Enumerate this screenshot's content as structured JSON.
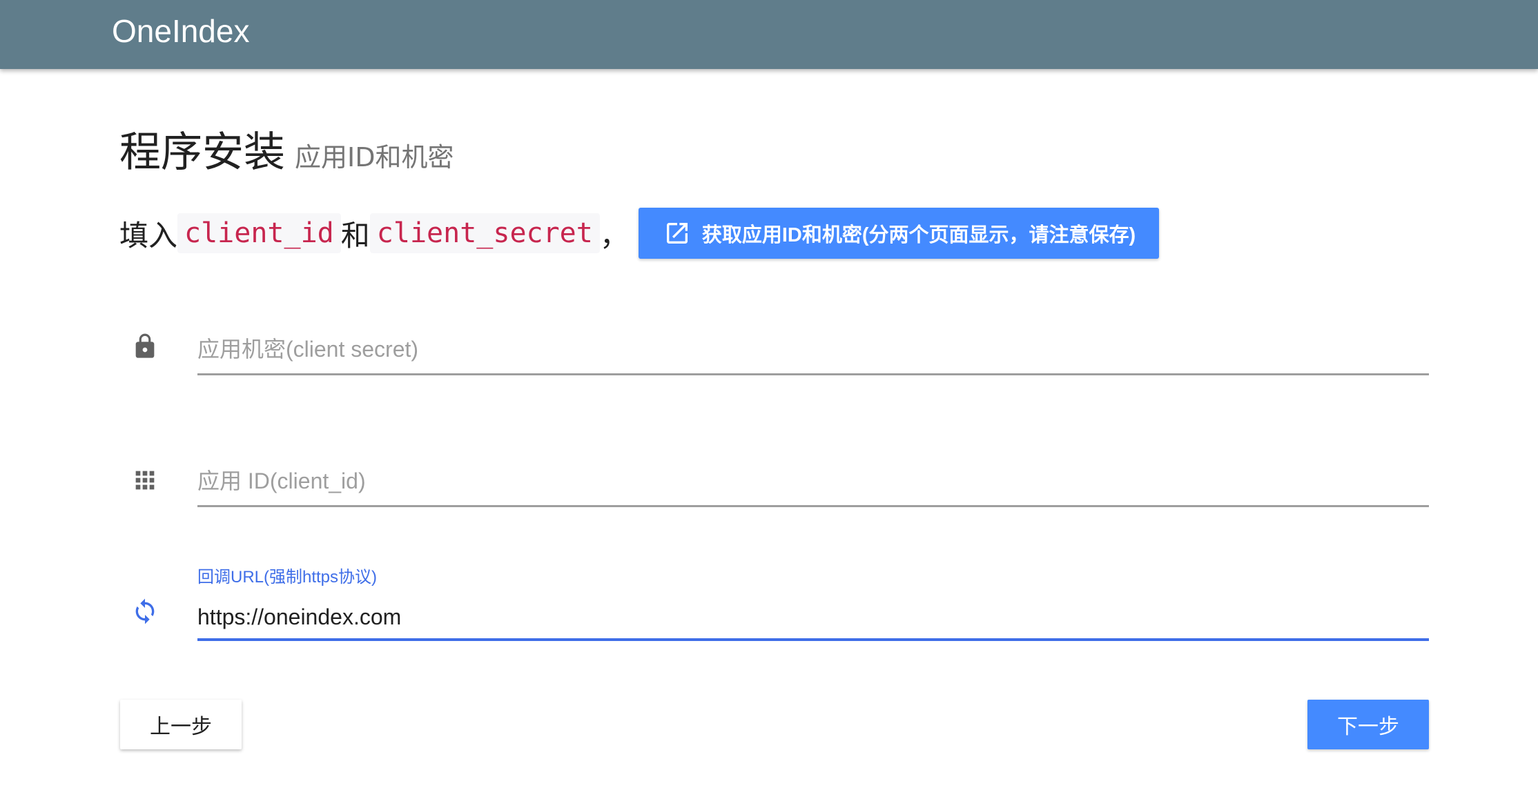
{
  "appbar": {
    "brand": "OneIndex"
  },
  "heading": {
    "title": "程序安装",
    "subtitle": "应用ID和机密"
  },
  "intro": {
    "prefix": "填入",
    "code1": "client_id",
    "joiner": "和",
    "code2": "client_secret",
    "suffix": "，",
    "link_button": "获取应用ID和机密(分两个页面显示，请注意保存)",
    "link_icon": "open-in-new-icon"
  },
  "fields": {
    "secret": {
      "placeholder": "应用机密(client secret)",
      "icon": "lock-icon",
      "value": ""
    },
    "client_id": {
      "placeholder": "应用 ID(client_id)",
      "icon": "apps-grid-icon",
      "value": ""
    },
    "redirect": {
      "label": "回调URL(强制https协议)",
      "value": "https://oneindex.com",
      "icon": "refresh-icon"
    }
  },
  "actions": {
    "prev": "上一步",
    "next": "下一步"
  },
  "colors": {
    "appbar": "#607d8b",
    "primary": "#448aff",
    "focus": "#3f6ee8",
    "code": "#c7254e"
  }
}
